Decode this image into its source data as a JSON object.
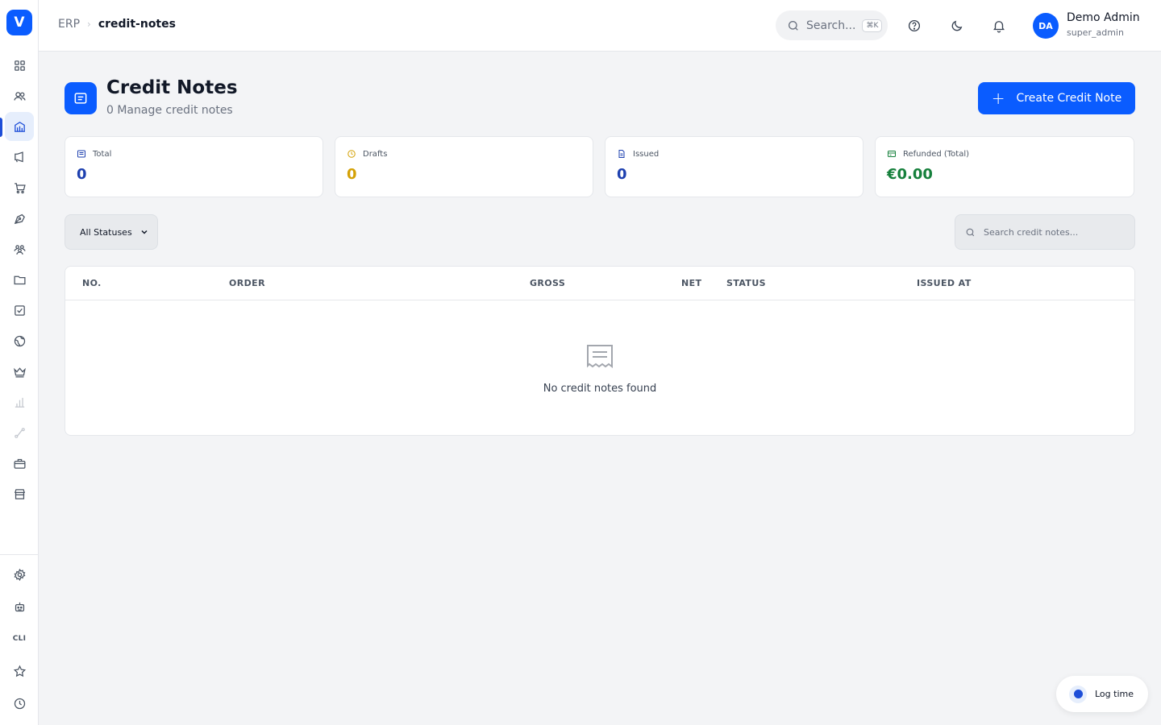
{
  "app": {
    "logo_letter": "V",
    "brand_color": "#0a5cff"
  },
  "sidebar": {
    "items": [
      {
        "icon": "dashboard-grid-icon"
      },
      {
        "icon": "users-icon"
      },
      {
        "icon": "building-bank-icon",
        "active": true
      },
      {
        "icon": "megaphone-icon"
      },
      {
        "icon": "shopping-cart-icon"
      },
      {
        "icon": "pen-tool-icon"
      },
      {
        "icon": "team-icon"
      },
      {
        "icon": "folder-icon"
      },
      {
        "icon": "checkbox-icon"
      },
      {
        "icon": "globe-icon"
      },
      {
        "icon": "crown-icon"
      },
      {
        "icon": "bar-chart-icon",
        "faded": true
      },
      {
        "icon": "route-icon",
        "faded": true
      },
      {
        "icon": "briefcase-icon"
      },
      {
        "icon": "store-icon"
      }
    ],
    "bottom_items": [
      {
        "icon": "settings-gear-icon"
      },
      {
        "icon": "robot-icon"
      },
      {
        "label": "CLI"
      },
      {
        "icon": "star-icon"
      },
      {
        "icon": "clock-icon"
      }
    ]
  },
  "topbar": {
    "breadcrumb": {
      "root": "ERP",
      "current": "credit-notes"
    },
    "search": {
      "placeholder": "Search...",
      "shortcut": "⌘K"
    },
    "icons": [
      "help-circle-icon",
      "moon-icon",
      "bell-icon"
    ],
    "user": {
      "initials": "DA",
      "name": "Demo Admin",
      "role": "super_admin"
    }
  },
  "header": {
    "title": "Credit Notes",
    "subtitle": "0 Manage credit notes",
    "create_button": "Create Credit Note"
  },
  "stats": [
    {
      "label": "Total",
      "value": "0",
      "color": "#1e40af",
      "icon": "list-icon"
    },
    {
      "label": "Drafts",
      "value": "0",
      "color": "#d4a106",
      "icon": "clock-icon"
    },
    {
      "label": "Issued",
      "value": "0",
      "color": "#1e40af",
      "icon": "document-icon"
    },
    {
      "label": "Refunded (Total)",
      "value": "€0.00",
      "color": "#16803c",
      "icon": "credit-card-icon"
    }
  ],
  "filters": {
    "status_select": "All Statuses",
    "search_placeholder": "Search credit notes..."
  },
  "table": {
    "columns": [
      "NO.",
      "ORDER",
      "GROSS",
      "NET",
      "STATUS",
      "ISSUED AT"
    ],
    "rows": [],
    "empty_text": "No credit notes found"
  },
  "log_time": {
    "label": "Log time"
  }
}
